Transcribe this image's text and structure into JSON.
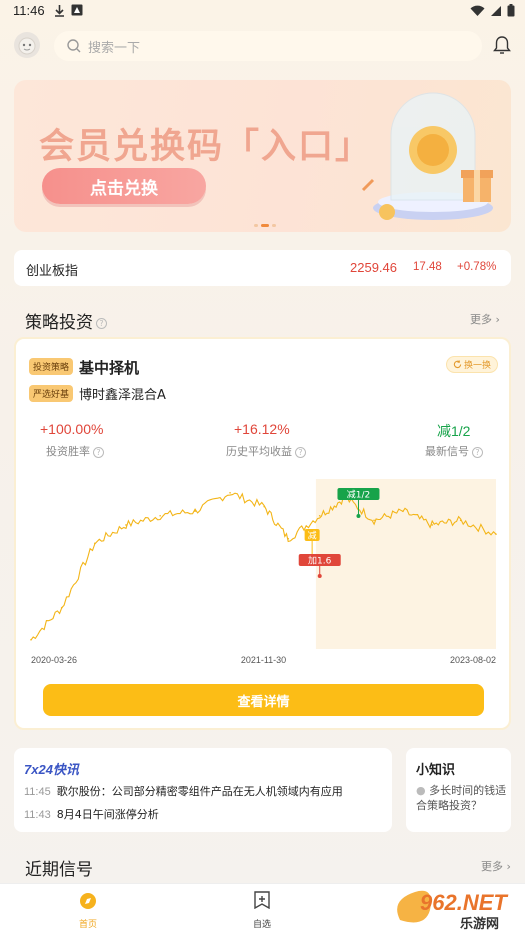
{
  "status_bar": {
    "time": "11:46"
  },
  "search": {
    "placeholder": "搜索一下"
  },
  "banner": {
    "title": "会员兑换码「入口」",
    "button_label": "点击兑换"
  },
  "index": {
    "name": "创业板指",
    "value": "2259.46",
    "change": "17.48",
    "change_pct": "+0.78%"
  },
  "strategy_section": {
    "title": "策略投资",
    "more": "更多"
  },
  "strategy": {
    "tag_strategy": "投资策略",
    "name": "基中择机",
    "tag_fund": "严选好基",
    "fund_name": "博时鑫泽混合A",
    "swap_label": "换一换",
    "metrics": [
      {
        "value": "+100.00%",
        "label": "投资胜率",
        "color": "#e0463a"
      },
      {
        "value": "+16.12%",
        "label": "历史平均收益",
        "color": "#e0463a"
      },
      {
        "value": "减1/2",
        "label": "最新信号",
        "color": "#17a34a"
      }
    ],
    "cta_label": "查看详情"
  },
  "chart_data": {
    "type": "line",
    "x_ticks": [
      "2020-03-26",
      "2021-11-30",
      "2023-08-02"
    ],
    "x": [
      "2020-03-26",
      "2020-06-15",
      "2020-09-10",
      "2020-12-01",
      "2021-03-01",
      "2021-06-01",
      "2021-09-01",
      "2021-11-30",
      "2022-02-01",
      "2022-04-25",
      "2022-07-01",
      "2022-09-15",
      "2022-11-30",
      "2023-02-15",
      "2023-05-01",
      "2023-08-02"
    ],
    "series": [
      {
        "color": "#f3b518",
        "values": [
          1.0,
          1.35,
          2.05,
          2.25,
          2.35,
          2.4,
          2.6,
          2.45,
          2.1,
          2.35,
          2.55,
          2.3,
          2.4,
          2.25,
          2.3,
          2.15
        ]
      }
    ],
    "signals": [
      {
        "label": "减",
        "x": "2022-04-05",
        "color": "#fcbd16"
      },
      {
        "label": "加1.6",
        "x": "2022-04-25",
        "color": "#e0463a"
      },
      {
        "label": "减1/2",
        "x": "2022-08-05",
        "color": "#17a34a"
      }
    ],
    "highlight_start": "2022-04-15",
    "grid": false,
    "ylim": [
      0.9,
      2.75
    ]
  },
  "news": {
    "brand": "7x24快讯",
    "items": [
      {
        "time": "11:45",
        "text": "歌尔股份：公司部分精密零组件产品在无人机领域内有应用"
      },
      {
        "time": "11:43",
        "text": "8月4日午间涨停分析"
      }
    ]
  },
  "knowledge": {
    "title": "小知识",
    "text": "多长时间的钱适合策略投资？"
  },
  "recent_signals": {
    "title": "近期信号",
    "more": "更多"
  },
  "tabbar": {
    "tabs": [
      {
        "label": "首页",
        "icon": "home-icon",
        "active": true
      },
      {
        "label": "自选",
        "icon": "watchlist-icon",
        "active": false
      }
    ]
  },
  "watermark": {
    "text": "962.NET",
    "sub": "乐游网"
  },
  "colors": {
    "accent": "#fcbd16",
    "up": "#e0463a",
    "down": "#17a34a"
  }
}
